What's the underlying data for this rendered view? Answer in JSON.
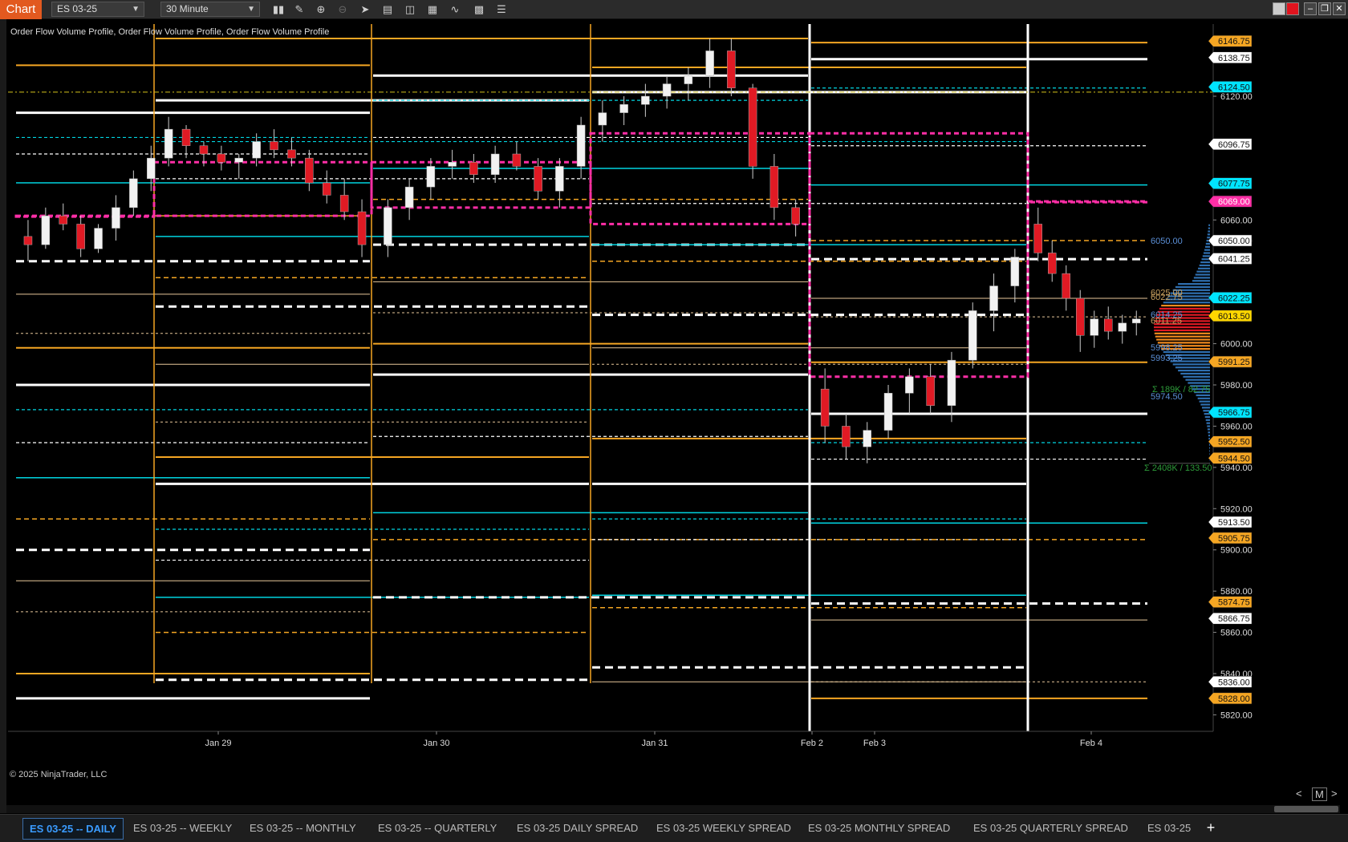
{
  "app_title": "Chart",
  "instrument": "ES 03-25",
  "timeframe": "30 Minute",
  "indicator_label": "Order Flow Volume Profile, Order Flow Volume Profile, Order Flow Volume Profile",
  "copyright": "© 2025 NinjaTrader, LLC",
  "toolbar_icons": [
    "bar-chart-icon",
    "pencil-icon",
    "zoom-in-icon",
    "zoom-out-icon",
    "cursor-icon",
    "properties-icon",
    "strategies-icon",
    "indicators-icon",
    "data-series-icon",
    "template-icon",
    "menu-icon"
  ],
  "zoom_label": "M",
  "tabs": [
    {
      "label": "ES 03-25 -- DAILY",
      "active": true
    },
    {
      "label": "ES 03-25 -- WEEKLY",
      "active": false
    },
    {
      "label": "ES 03-25 -- MONTHLY",
      "active": false
    },
    {
      "label": "ES 03-25 -- QUARTERLY",
      "active": false
    },
    {
      "label": "ES 03-25 DAILY SPREAD",
      "active": false
    },
    {
      "label": "ES 03-25 WEEKLY SPREAD",
      "active": false
    },
    {
      "label": "ES 03-25 MONTHLY SPREAD",
      "active": false
    },
    {
      "label": "ES 03-25 QUARTERLY SPREAD",
      "active": false
    },
    {
      "label": "ES 03-25",
      "active": false
    }
  ],
  "add_tab": "+",
  "chart_data": {
    "type": "candlestick",
    "x_ticks": [
      "Jan 29",
      "Jan 30",
      "Jan 31",
      "Feb 2",
      "Feb 3",
      "Feb 4"
    ],
    "y_ticks": [
      6120.0,
      6060.0,
      6050.0,
      6000.0,
      5980.0,
      5960.0,
      5940.0,
      5920.0,
      5900.0,
      5880.0,
      5860.0,
      5840.0,
      5820.0
    ],
    "y_range": [
      5812,
      6155
    ],
    "price_markers": [
      {
        "value": "6146.75",
        "color": "#f5a623"
      },
      {
        "value": "6138.75",
        "color": "#ffffff"
      },
      {
        "value": "6124.50",
        "color": "#00e5ff"
      },
      {
        "value": "6096.75",
        "color": "#ffffff"
      },
      {
        "value": "6077.75",
        "color": "#00e5ff"
      },
      {
        "value": "6069.00",
        "color": "#ff2ea6"
      },
      {
        "value": "6050.00",
        "color": "#ffffff"
      },
      {
        "value": "6041.25",
        "color": "#ffffff"
      },
      {
        "value": "6022.25",
        "color": "#00e5ff"
      },
      {
        "value": "6013.50",
        "color": "#ffd700"
      },
      {
        "value": "5991.25",
        "color": "#f5a623"
      },
      {
        "value": "5966.75",
        "color": "#00e5ff"
      },
      {
        "value": "5952.50",
        "color": "#f5a623"
      },
      {
        "value": "5944.50",
        "color": "#f5a623"
      },
      {
        "value": "5913.50",
        "color": "#ffffff"
      },
      {
        "value": "5905.75",
        "color": "#f5a623"
      },
      {
        "value": "5874.75",
        "color": "#f5a623"
      },
      {
        "value": "5866.75",
        "color": "#ffffff"
      },
      {
        "value": "5836.00",
        "color": "#ffffff"
      },
      {
        "value": "5828.00",
        "color": "#f5a623"
      }
    ],
    "profile_labels": [
      {
        "value": "6050.00",
        "color": "#5b8fd6"
      },
      {
        "value": "6025.00",
        "color": "#c8a060"
      },
      {
        "value": "6022.75",
        "color": "#c8a060"
      },
      {
        "value": "6014.25",
        "color": "#5b8fd6"
      },
      {
        "value": "6011.25",
        "color": "#c8a060"
      },
      {
        "value": "5998.25",
        "color": "#5b8fd6"
      },
      {
        "value": "5993.25",
        "color": "#5b8fd6"
      },
      {
        "value": "5974.50",
        "color": "#5b8fd6"
      }
    ],
    "profile_stats": [
      {
        "text": "Σ  189K / 82.75",
        "color": "#2e9b3a"
      },
      {
        "text": "Σ  2408K / 133.50",
        "color": "#2e9b3a"
      }
    ],
    "candles": [
      [
        6052,
        6060,
        6040,
        6048
      ],
      [
        6048,
        6066,
        6046,
        6062
      ],
      [
        6062,
        6068,
        6055,
        6058
      ],
      [
        6058,
        6062,
        6042,
        6046
      ],
      [
        6046,
        6058,
        6044,
        6056
      ],
      [
        6056,
        6072,
        6050,
        6066
      ],
      [
        6066,
        6084,
        6062,
        6080
      ],
      [
        6080,
        6096,
        6074,
        6090
      ],
      [
        6090,
        6110,
        6086,
        6104
      ],
      [
        6104,
        6106,
        6090,
        6096
      ],
      [
        6096,
        6098,
        6086,
        6092
      ],
      [
        6092,
        6096,
        6084,
        6088
      ],
      [
        6088,
        6092,
        6080,
        6090
      ],
      [
        6090,
        6102,
        6086,
        6098
      ],
      [
        6098,
        6104,
        6090,
        6094
      ],
      [
        6094,
        6100,
        6086,
        6090
      ],
      [
        6090,
        6094,
        6074,
        6078
      ],
      [
        6078,
        6084,
        6068,
        6072
      ],
      [
        6072,
        6080,
        6060,
        6064
      ],
      [
        6064,
        6070,
        6042,
        6048
      ],
      [
        6048,
        6070,
        6042,
        6066
      ],
      [
        6066,
        6080,
        6060,
        6076
      ],
      [
        6076,
        6090,
        6070,
        6086
      ],
      [
        6086,
        6094,
        6080,
        6088
      ],
      [
        6088,
        6092,
        6078,
        6082
      ],
      [
        6082,
        6096,
        6078,
        6092
      ],
      [
        6092,
        6098,
        6084,
        6086
      ],
      [
        6086,
        6090,
        6070,
        6074
      ],
      [
        6074,
        6090,
        6066,
        6086
      ],
      [
        6086,
        6110,
        6080,
        6106
      ],
      [
        6106,
        6118,
        6098,
        6112
      ],
      [
        6112,
        6120,
        6106,
        6116
      ],
      [
        6116,
        6126,
        6110,
        6120
      ],
      [
        6120,
        6130,
        6114,
        6126
      ],
      [
        6126,
        6134,
        6118,
        6130
      ],
      [
        6130,
        6148,
        6124,
        6142
      ],
      [
        6142,
        6148,
        6120,
        6124
      ],
      [
        6124,
        6126,
        6080,
        6086
      ],
      [
        6086,
        6092,
        6060,
        6066
      ],
      [
        6066,
        6070,
        6052,
        6058
      ],
      [
        5978,
        5988,
        5952,
        5960
      ],
      [
        5960,
        5966,
        5944,
        5950
      ],
      [
        5950,
        5962,
        5942,
        5958
      ],
      [
        5958,
        5980,
        5954,
        5976
      ],
      [
        5976,
        5988,
        5966,
        5984
      ],
      [
        5984,
        5990,
        5966,
        5970
      ],
      [
        5970,
        5996,
        5962,
        5992
      ],
      [
        5992,
        6020,
        5988,
        6016
      ],
      [
        6016,
        6034,
        6006,
        6028
      ],
      [
        6028,
        6046,
        6020,
        6042
      ],
      [
        6058,
        6066,
        6040,
        6044
      ],
      [
        6044,
        6050,
        6030,
        6034
      ],
      [
        6034,
        6038,
        6016,
        6022
      ],
      [
        6022,
        6026,
        5996,
        6004
      ],
      [
        6004,
        6016,
        5998,
        6012
      ],
      [
        6012,
        6018,
        6002,
        6006
      ],
      [
        6006,
        6014,
        6000,
        6010
      ],
      [
        6010,
        6016,
        6004,
        6012
      ]
    ]
  }
}
